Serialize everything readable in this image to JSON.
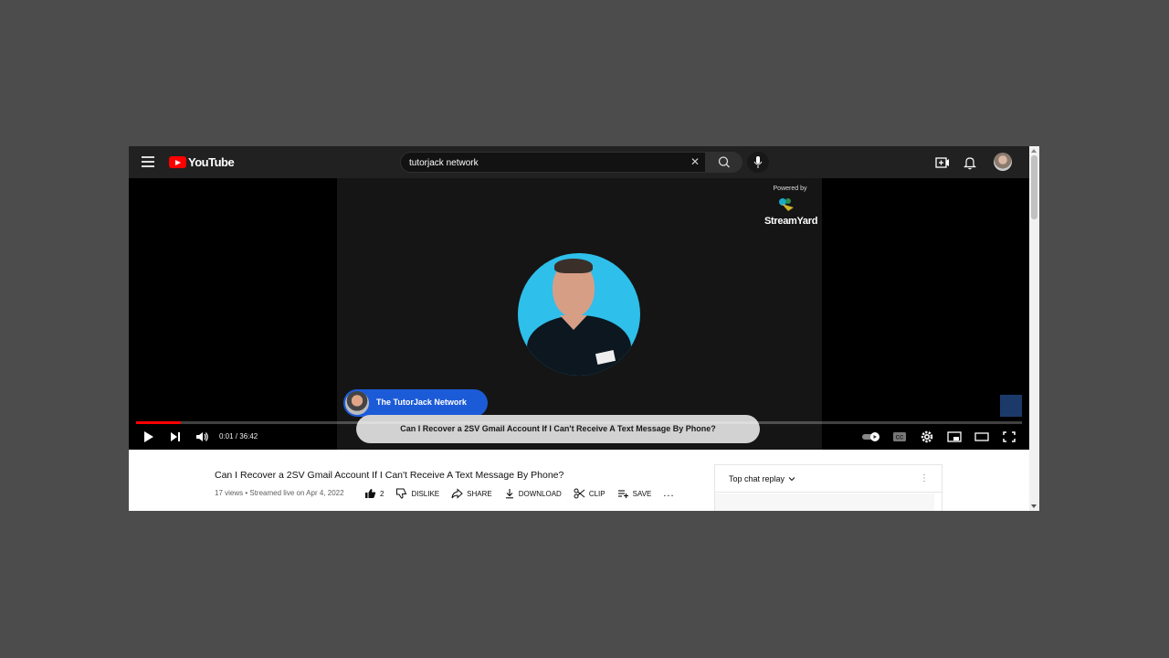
{
  "header": {
    "logo_text": "YouTube",
    "search_value": "tutorjack network"
  },
  "video": {
    "powered_by": "Powered by",
    "streamyard": "StreamYard",
    "host_name": "The TutorJack Network",
    "caption": "Can I Recover a 2SV Gmail Account If I Can't Receive A Text Message By Phone?",
    "time": "0:01 / 36:42",
    "progress_fraction": 0.05
  },
  "details": {
    "title": "Can I Recover a 2SV Gmail Account If I Can't Receive A Text Message By Phone?",
    "meta": "17 views • Streamed live on Apr 4, 2022",
    "likes": "2",
    "dislike": "DISLIKE",
    "share": "SHARE",
    "download": "DOWNLOAD",
    "clip": "CLIP",
    "save": "SAVE",
    "more": "..."
  },
  "chat": {
    "label": "Top chat replay",
    "menu": "⋮"
  },
  "colors": {
    "accent": "#ff0000",
    "topbar": "#212121",
    "pill": "#1c5bd8",
    "face_bg": "#2ebfea"
  },
  "icons": [
    "menu-icon",
    "youtube-logo-icon",
    "search-icon",
    "clear-icon",
    "mic-icon",
    "create-video-icon",
    "notifications-icon",
    "play-icon",
    "next-icon",
    "volume-icon",
    "autoplay-toggle-icon",
    "captions-icon",
    "settings-icon",
    "miniplayer-icon",
    "theater-icon",
    "fullscreen-icon",
    "like-icon",
    "dislike-icon",
    "share-icon",
    "download-icon",
    "clip-icon",
    "save-icon"
  ]
}
